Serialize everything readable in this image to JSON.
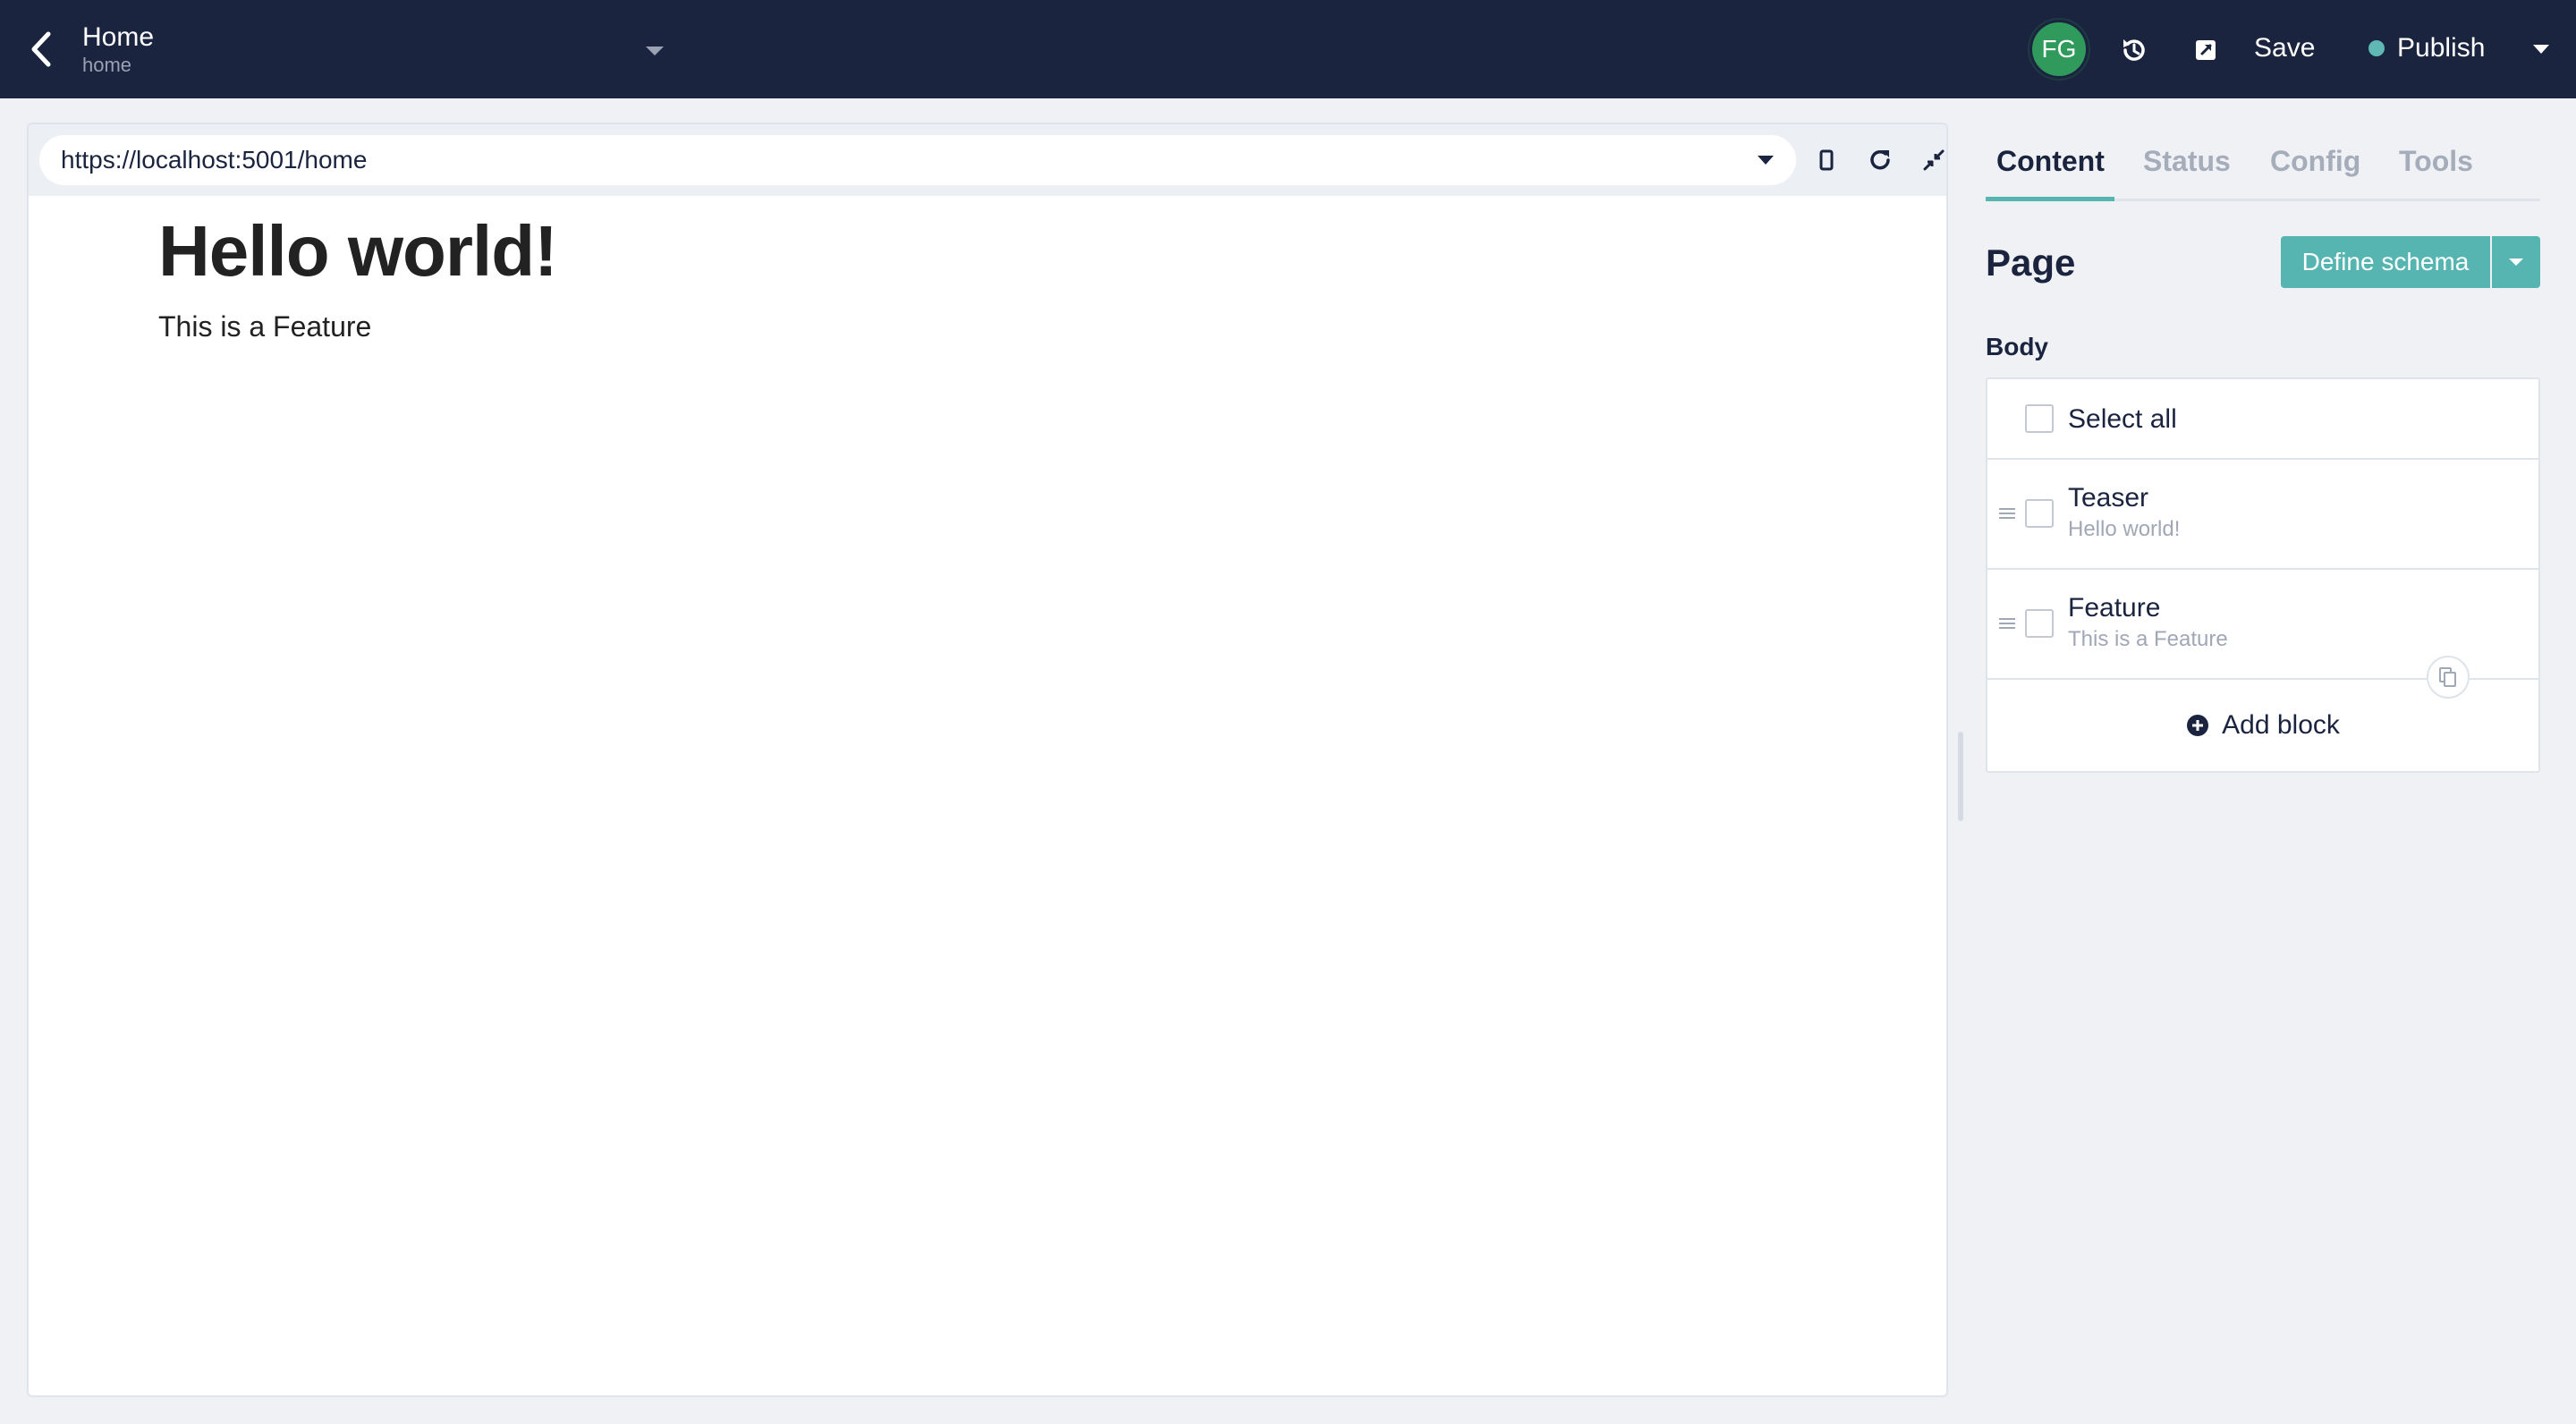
{
  "header": {
    "title": "Home",
    "slug": "home",
    "avatar_initials": "FG",
    "save_label": "Save",
    "publish_label": "Publish"
  },
  "preview": {
    "url": "https://localhost:5001/home",
    "heading": "Hello world!",
    "text": "This is a Feature"
  },
  "sidebar": {
    "tabs": [
      {
        "label": "Content"
      },
      {
        "label": "Status"
      },
      {
        "label": "Config"
      },
      {
        "label": "Tools"
      }
    ],
    "page_heading": "Page",
    "define_schema_label": "Define schema",
    "body_label": "Body",
    "select_all_label": "Select all",
    "blocks": [
      {
        "label": "Teaser",
        "preview": "Hello world!"
      },
      {
        "label": "Feature",
        "preview": "This is a Feature"
      }
    ],
    "add_block_label": "Add block"
  },
  "colors": {
    "header_bg": "#1b243f",
    "accent": "#56b5b0",
    "avatar": "#2f9a5c"
  }
}
